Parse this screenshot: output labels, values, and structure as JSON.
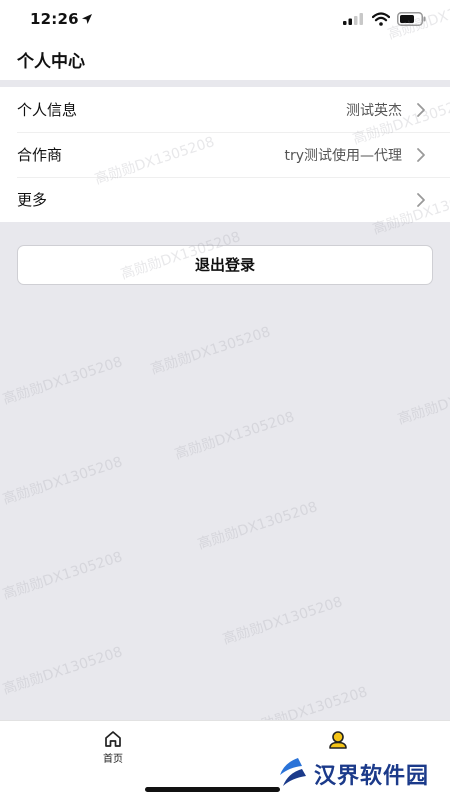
{
  "status_bar": {
    "time": "12:26"
  },
  "header": {
    "title": "个人中心"
  },
  "menu": [
    {
      "label": "个人信息",
      "value": "测试英杰"
    },
    {
      "label": "合作商",
      "value": "try测试使用—代理"
    },
    {
      "label": "更多",
      "value": ""
    }
  ],
  "logout": {
    "label": "退出登录"
  },
  "watermark": {
    "text": "高勋勋DX1305208"
  },
  "tabs": [
    {
      "label": "首页",
      "icon": "home-icon"
    },
    {
      "label": "",
      "icon": "profile-icon",
      "active_color": "#f5c518"
    }
  ],
  "logo": {
    "text": "汉界软件园"
  }
}
